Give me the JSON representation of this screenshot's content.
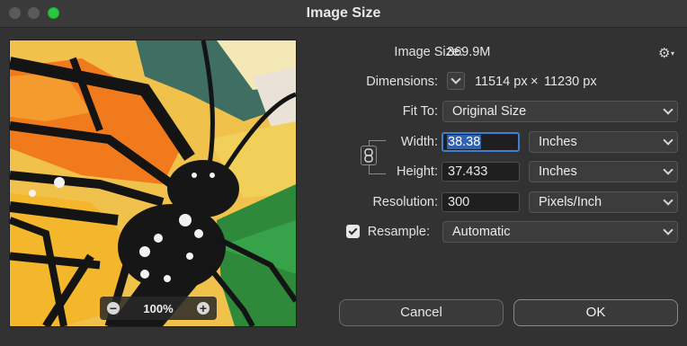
{
  "window": {
    "title": "Image Size"
  },
  "preview": {
    "zoom": "100%",
    "zoom_out": "−",
    "zoom_in": "+"
  },
  "image_size": {
    "label": "Image Size:",
    "value": "369.9M"
  },
  "dimensions": {
    "label": "Dimensions:",
    "width": "11514 px",
    "times": "×",
    "height": "11230 px"
  },
  "fit_to": {
    "label": "Fit To:",
    "value": "Original Size"
  },
  "width": {
    "label": "Width:",
    "value": "38.38",
    "unit": "Inches"
  },
  "height": {
    "label": "Height:",
    "value": "37.433",
    "unit": "Inches"
  },
  "resolution": {
    "label": "Resolution:",
    "value": "300",
    "unit": "Pixels/Inch"
  },
  "resample": {
    "label": "Resample:",
    "value": "Automatic",
    "checked": true
  },
  "buttons": {
    "cancel": "Cancel",
    "ok": "OK"
  }
}
